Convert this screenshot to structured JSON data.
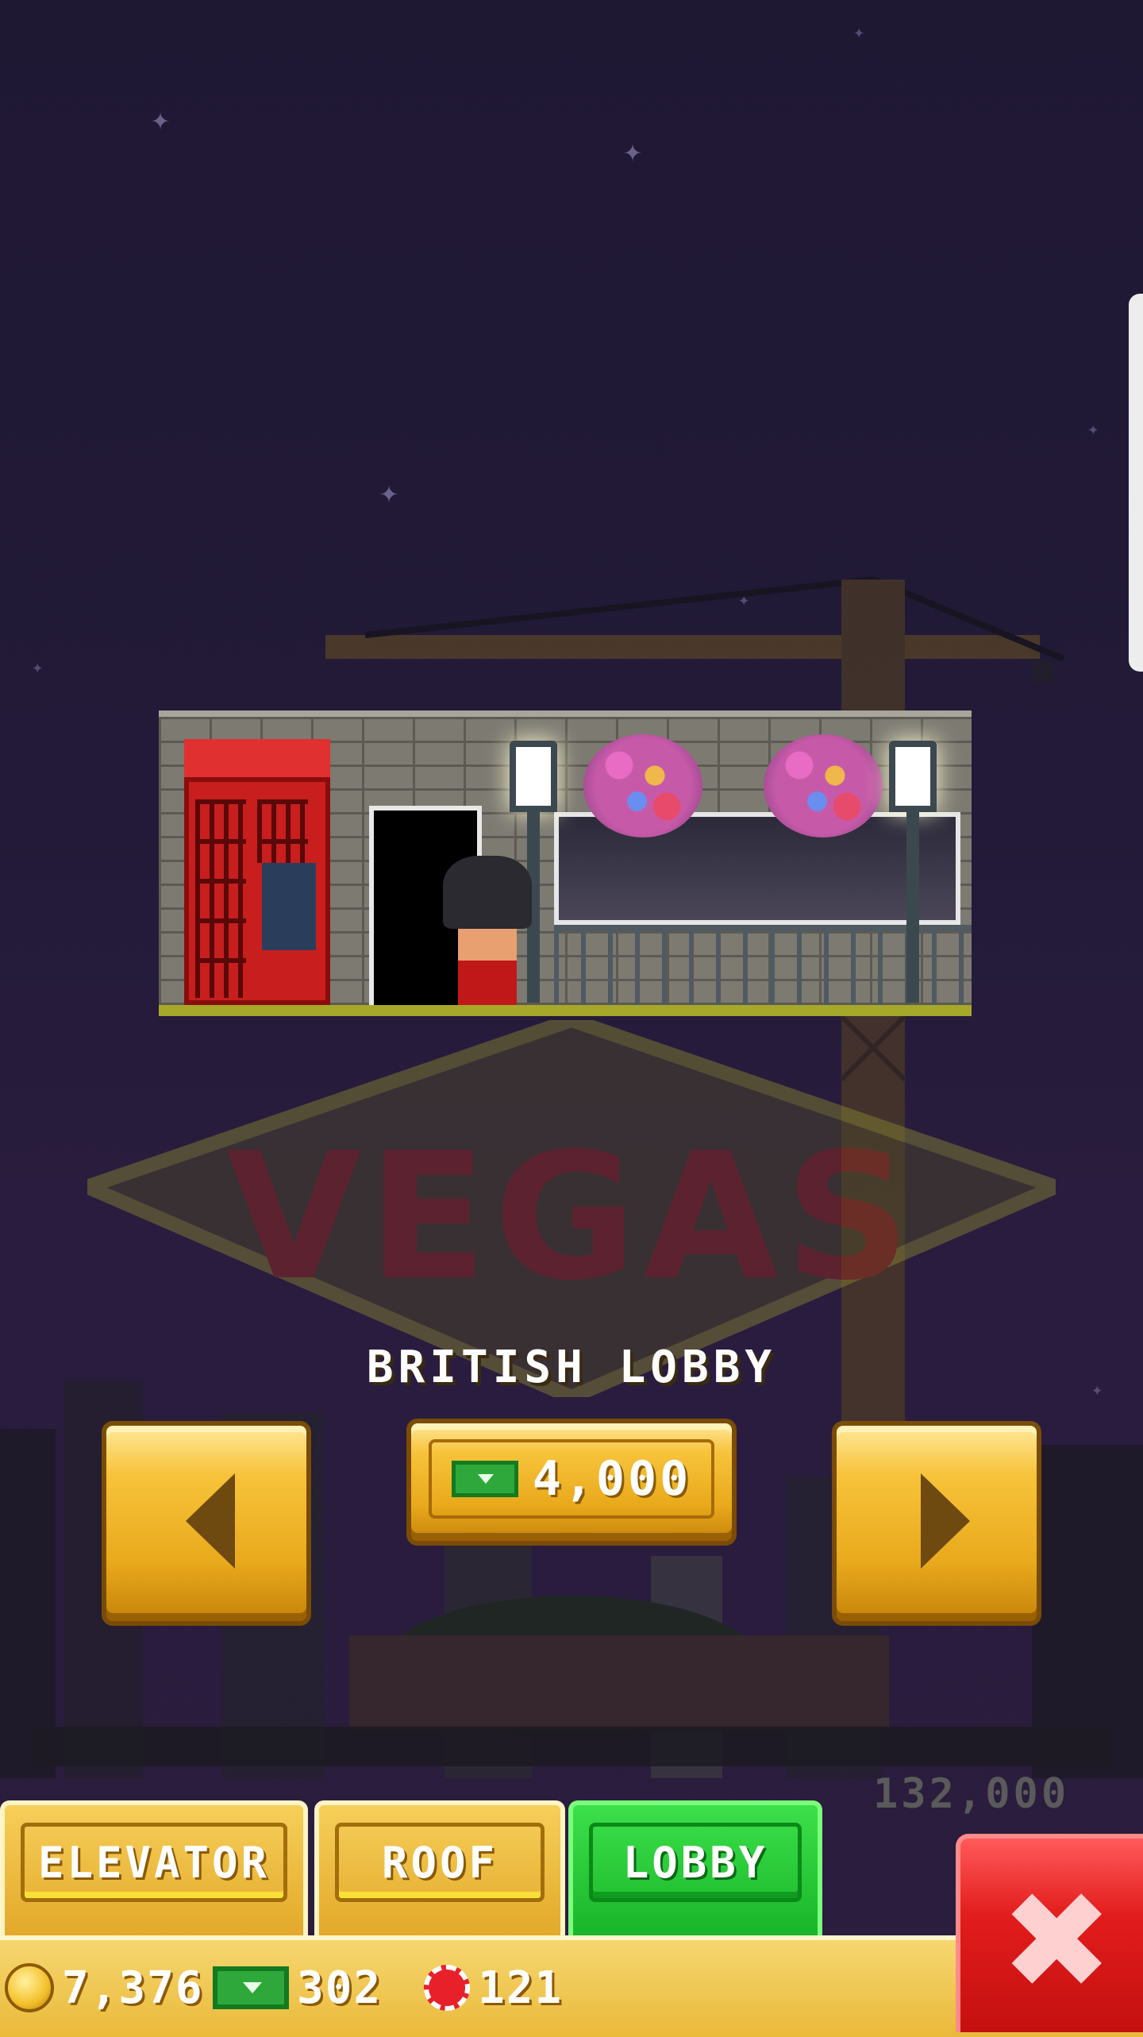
{
  "room": {
    "name": "BRITISH LOBBY",
    "price": "4,000",
    "price_currency_icon": "tower-bux-icon",
    "background_sign": "VEGAS",
    "background_floor_value": "132,000"
  },
  "navigation": {
    "prev_icon": "arrow-left-icon",
    "next_icon": "arrow-right-icon"
  },
  "tabs": [
    {
      "label": "ELEVATOR",
      "active": false
    },
    {
      "label": "ROOF",
      "active": false
    },
    {
      "label": "LOBBY",
      "active": true
    }
  ],
  "currency": {
    "coins": "7,376",
    "bux": "302",
    "chips": "121"
  },
  "colors": {
    "gold": "#f7c33a",
    "active_tab": "#19b52a",
    "close": "#e21c1c",
    "sky": "#221a38"
  }
}
